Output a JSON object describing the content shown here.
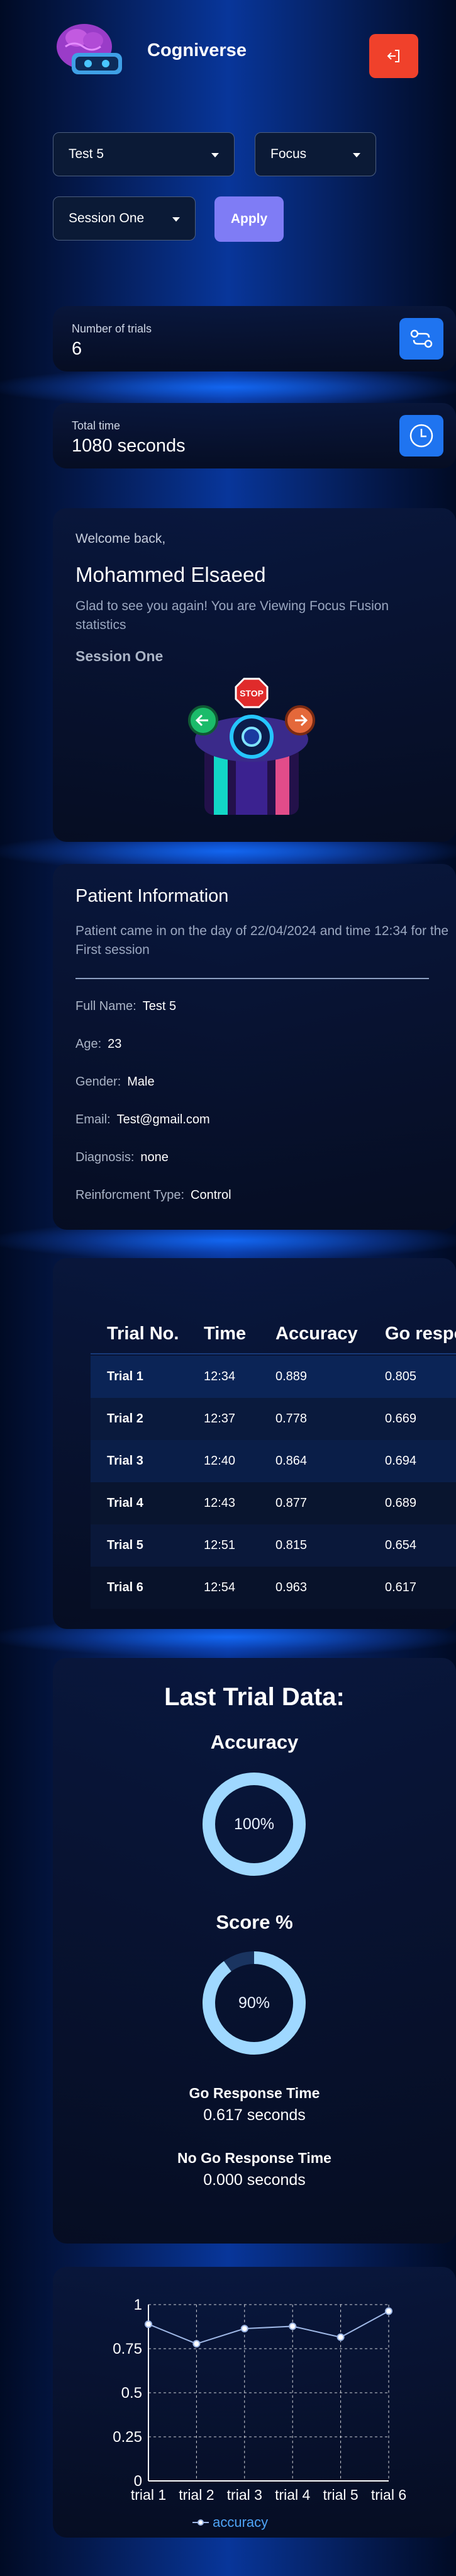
{
  "header": {
    "app_title": "Cogniverse",
    "logout_icon": "logout-icon",
    "accent": "#f0412b"
  },
  "filters": {
    "patient": "Test 5",
    "mode": "Focus",
    "session": "Session One",
    "apply_label": "Apply"
  },
  "stats": [
    {
      "label": "Number of trials",
      "value": "6",
      "icon": "trials-icon"
    },
    {
      "label": "Total time",
      "value": "1080 seconds",
      "icon": "clock-icon"
    }
  ],
  "welcome": {
    "greeting": "Welcome back,",
    "name": "Mohammed Elsaeed",
    "subtitle": "Glad to see you again! You are Viewing Focus Fusion statistics",
    "session": "Session One"
  },
  "patient": {
    "title": "Patient Information",
    "subtitle": "Patient came in on the day of 22/04/2024 and time 12:34 for the First session",
    "fields": [
      {
        "label": "Full Name:",
        "value": "Test 5"
      },
      {
        "label": "Age:",
        "value": "23"
      },
      {
        "label": "Gender:",
        "value": "Male"
      },
      {
        "label": "Email:",
        "value": "Test@gmail.com"
      },
      {
        "label": "Diagnosis:",
        "value": "none"
      },
      {
        "label": "Reinforcment Type:",
        "value": "Control"
      }
    ]
  },
  "trials_table": {
    "columns": [
      "Trial No.",
      "Time",
      "Accuracy",
      "Go response"
    ],
    "rows": [
      [
        "Trial 1",
        "12:34",
        "0.889",
        "0.805"
      ],
      [
        "Trial 2",
        "12:37",
        "0.778",
        "0.669"
      ],
      [
        "Trial 3",
        "12:40",
        "0.864",
        "0.694"
      ],
      [
        "Trial 4",
        "12:43",
        "0.877",
        "0.689"
      ],
      [
        "Trial 5",
        "12:51",
        "0.815",
        "0.654"
      ],
      [
        "Trial 6",
        "12:54",
        "0.963",
        "0.617"
      ]
    ]
  },
  "last_trial": {
    "title": "Last Trial Data:",
    "accuracy_title": "Accuracy",
    "accuracy_text": "100%",
    "accuracy_value": 1.0,
    "score_title": "Score %",
    "score_text": "90%",
    "score_value": 0.9,
    "go_label": "Go Response Time",
    "go_value": "0.617 seconds",
    "nogo_label": "No Go Response Time",
    "nogo_value": "0.000 seconds",
    "ring_color": "#9fd8ff"
  },
  "chart_data": {
    "type": "line",
    "categories": [
      "trial 1",
      "trial 2",
      "trial 3",
      "trial 4",
      "trial 5",
      "trial 6"
    ],
    "series": [
      {
        "name": "accuracy",
        "values": [
          0.889,
          0.778,
          0.864,
          0.877,
          0.815,
          0.963
        ]
      }
    ],
    "y_ticks": [
      "0",
      "0.25",
      "0.5",
      "0.75",
      "1"
    ],
    "ylim": [
      0,
      1
    ],
    "grid": true,
    "legend": "bottom",
    "line_color": "#9fb8e6"
  }
}
